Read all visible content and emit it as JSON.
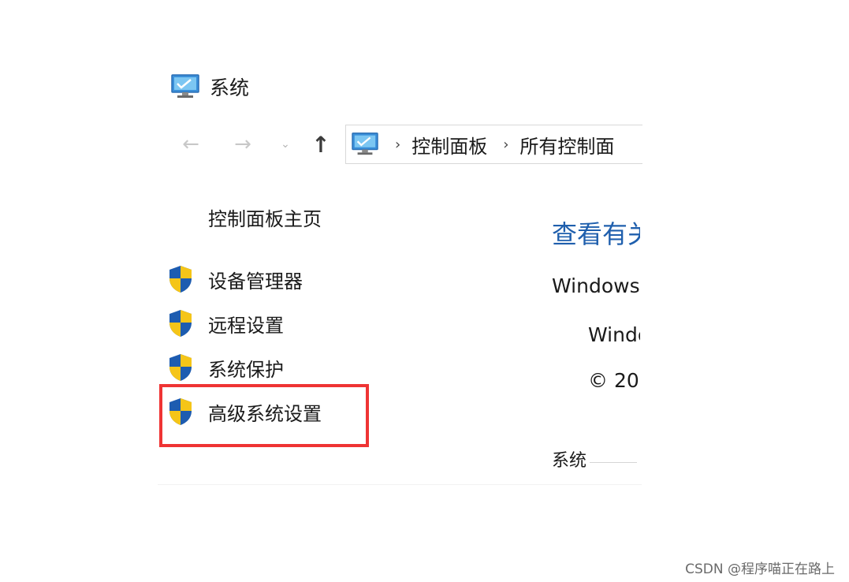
{
  "window": {
    "title": "系统",
    "icon": "monitor-icon"
  },
  "nav": {
    "back_icon": "←",
    "forward_icon": "→",
    "dropdown_icon": "⌄",
    "up_icon": "↑",
    "address": {
      "icon": "monitor-icon",
      "separator": "›",
      "crumbs": [
        "控制面板",
        "所有控制面"
      ]
    }
  },
  "sidebar": {
    "home_link": "控制面板主页",
    "items": [
      {
        "label": "设备管理器",
        "icon": "uac-shield-icon"
      },
      {
        "label": "远程设置",
        "icon": "uac-shield-icon"
      },
      {
        "label": "系统保护",
        "icon": "uac-shield-icon"
      },
      {
        "label": "高级系统设置",
        "icon": "uac-shield-icon",
        "highlighted": true
      }
    ]
  },
  "main": {
    "heading": "查看有关",
    "windows_edition_label": "Windows",
    "windows_name": "Windows",
    "copyright": "© 20",
    "section_title": "系统"
  },
  "colors": {
    "heading": "#1f5fad",
    "highlight": "#ef3434",
    "shield_blue": "#1d5cb0",
    "shield_yellow": "#f5c518"
  },
  "watermark": "CSDN @程序喵正在路上"
}
